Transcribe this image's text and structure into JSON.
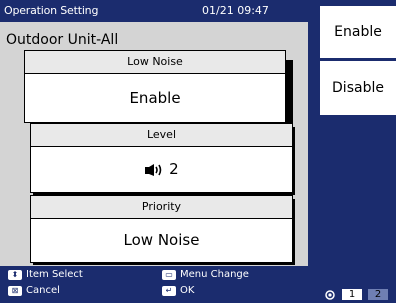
{
  "header": {
    "title": "Operation Setting",
    "datetime": "01/21 09:47"
  },
  "panel": {
    "unit": "Outdoor Unit-All",
    "low_noise": {
      "label": "Low Noise",
      "value": "Enable"
    },
    "level": {
      "label": "Level",
      "value": "2",
      "icon": "speaker-icon"
    },
    "priority": {
      "label": "Priority",
      "value": "Low Noise"
    }
  },
  "options": [
    "Enable",
    "Disable"
  ],
  "footer": {
    "item_select": "Item Select",
    "cancel": "Cancel",
    "menu_change": "Menu Change",
    "ok": "OK"
  },
  "pages": {
    "current": "1",
    "next": "2"
  }
}
